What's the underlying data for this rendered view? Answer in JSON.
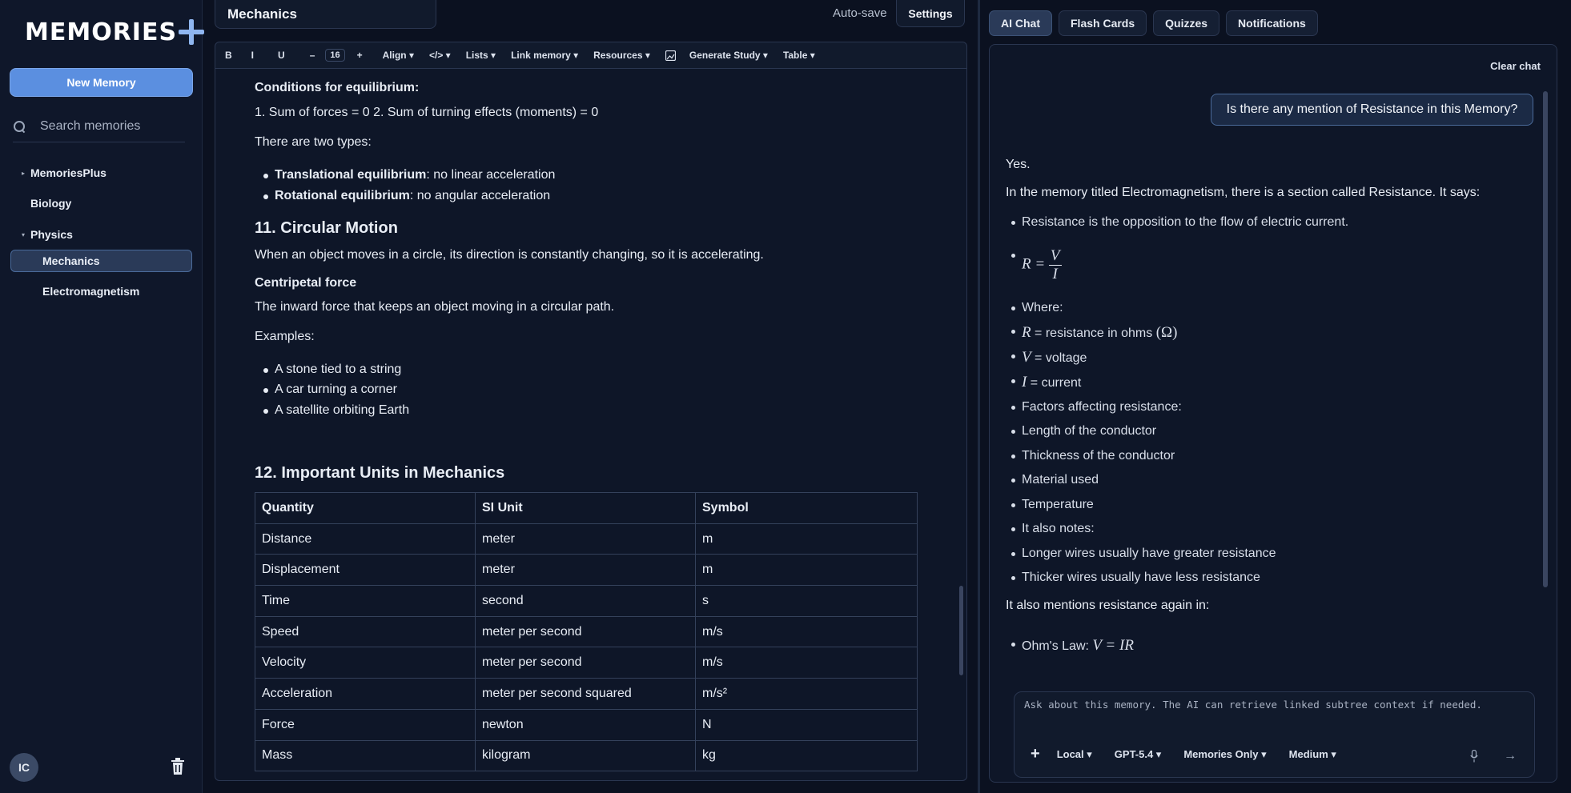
{
  "sidebar": {
    "logo": "MEMORIES",
    "new_memory": "New Memory",
    "search_placeholder": "Search memories",
    "tree": [
      {
        "label": "MemoriesPlus",
        "caret": "▸"
      },
      {
        "label": "Biology",
        "caret": ""
      },
      {
        "label": "Physics",
        "caret": "▾"
      },
      {
        "label": "Mechanics",
        "caret": ""
      },
      {
        "label": "Electromagnetism",
        "caret": ""
      }
    ],
    "avatar": "IC"
  },
  "editor": {
    "title": "Mechanics",
    "autosave": "Auto-save",
    "settings": "Settings",
    "toolbar": {
      "bold": "B",
      "italic": "I",
      "underline": "U",
      "minus": "–",
      "font_size": "16",
      "plus": "+",
      "align": "Align ▾",
      "code": "</> ▾",
      "lists": "Lists ▾",
      "link_memory": "Link memory ▾",
      "resources": "Resources ▾",
      "generate_study": "Generate Study ▾",
      "table": "Table ▾"
    },
    "content": {
      "eq_heading": "Conditions for equilibrium:",
      "eq_line": "1. Sum of forces = 0 2. Sum of turning effects (moments) = 0",
      "types_intro": "There are two types:",
      "type1_bold": "Translational equilibrium",
      "type1_rest": ": no linear acceleration",
      "type2_bold": "Rotational equilibrium",
      "type2_rest": ": no angular acceleration",
      "circ_heading": "11. Circular Motion",
      "circ_text": "When an object moves in a circle, its direction is constantly changing, so it is accelerating.",
      "centri_heading": "Centripetal force",
      "centri_text": "The inward force that keeps an object moving in a circular path.",
      "examples_label": "Examples:",
      "examples": [
        "A stone tied to a string",
        "A car turning a corner",
        "A satellite orbiting Earth"
      ],
      "units_heading": "12. Important Units in Mechanics"
    },
    "table": {
      "headers": [
        "Quantity",
        "SI Unit",
        "Symbol"
      ],
      "rows": [
        [
          "Distance",
          "meter",
          "m"
        ],
        [
          "Displacement",
          "meter",
          "m"
        ],
        [
          "Time",
          "second",
          "s"
        ],
        [
          "Speed",
          "meter per second",
          "m/s"
        ],
        [
          "Velocity",
          "meter per second",
          "m/s"
        ],
        [
          "Acceleration",
          "meter per second squared",
          "m/s²"
        ],
        [
          "Force",
          "newton",
          "N"
        ],
        [
          "Mass",
          "kilogram",
          "kg"
        ]
      ]
    }
  },
  "right_panel": {
    "tabs": [
      "AI Chat",
      "Flash Cards",
      "Quizzes",
      "Notifications"
    ],
    "active_tab": "AI Chat",
    "clear_chat": "Clear chat",
    "user_message": "Is there any mention of Resistance in this Memory?",
    "answer": {
      "yes": "Yes.",
      "intro": "In the memory titled Electromagnetism, there is a section called Resistance. It says:",
      "bullet1": "Resistance is the opposition to the flow of electric current.",
      "formula_lhs": "R =",
      "formula_num": "V",
      "formula_den": "I",
      "where": "Where:",
      "r_sym": "R",
      "r_text": " = resistance in ohms ",
      "ohm_sym": "(Ω)",
      "v_sym": "V",
      "v_text": " = voltage",
      "i_sym": "I",
      "i_text": " = current",
      "factors": "Factors affecting resistance:",
      "factor_list": [
        "Length of the conductor",
        "Thickness of the conductor",
        "Material used",
        "Temperature"
      ],
      "also_notes": "It also notes:",
      "notes": [
        "Longer wires usually have greater resistance",
        "Thicker wires usually have less resistance"
      ],
      "again": "It also mentions resistance again in:",
      "ohms_law_label": "Ohm's Law: ",
      "ohms_law_formula": "V = IR"
    },
    "input_placeholder": "Ask about this memory. The AI can retrieve linked subtree context if needed.",
    "input_controls": {
      "plus": "+",
      "source": "Local ▾",
      "model": "GPT-5.4 ▾",
      "scope": "Memories Only ▾",
      "effort": "Medium ▾",
      "send": "→"
    }
  },
  "colors": {
    "background": "#0b1120",
    "accent": "#5b8fe0",
    "selected": "#2a3a58"
  }
}
